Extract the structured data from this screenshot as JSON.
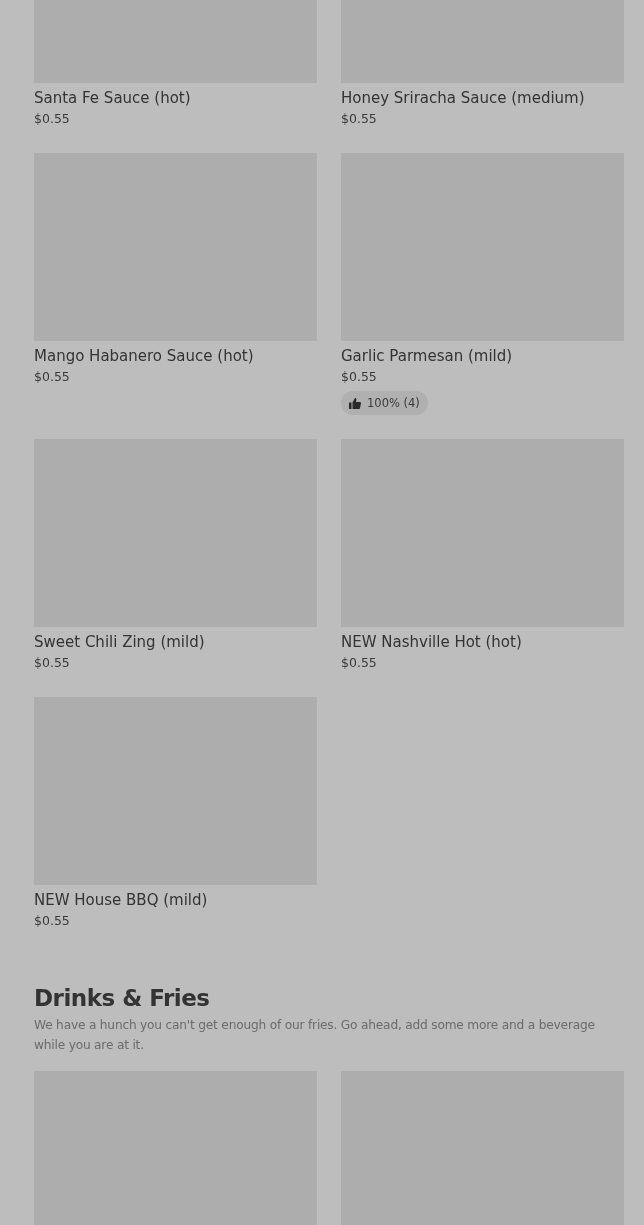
{
  "sections": [
    {
      "items": [
        {
          "name": "Santa Fe Sauce (hot)",
          "price": "$0.55"
        },
        {
          "name": "Honey Sriracha Sauce (medium)",
          "price": "$0.55"
        },
        {
          "name": "Mango Habanero Sauce (hot)",
          "price": "$0.55"
        },
        {
          "name": "Garlic Parmesan (mild)",
          "price": "$0.55",
          "rating": "100% (4)"
        },
        {
          "name": "Sweet Chili Zing (mild)",
          "price": "$0.55"
        },
        {
          "name": "NEW Nashville Hot (hot)",
          "price": "$0.55"
        },
        {
          "name": "NEW House BBQ (mild)",
          "price": "$0.55"
        }
      ]
    },
    {
      "title": "Drinks & Fries",
      "description": "We have a hunch you can't get enough of our fries. Go ahead, add some more and a beverage while you are at it."
    }
  ]
}
